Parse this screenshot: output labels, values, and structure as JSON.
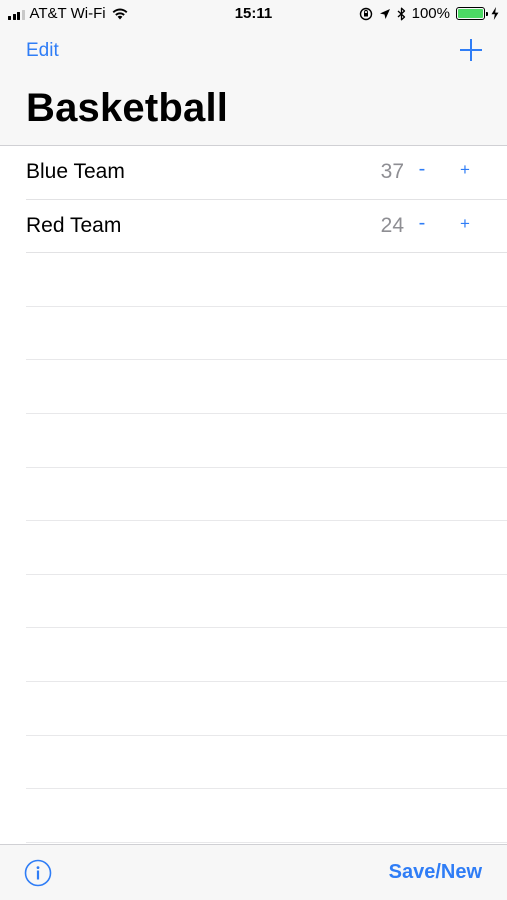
{
  "status_bar": {
    "carrier": "AT&T Wi-Fi",
    "time": "15:11",
    "battery": "100%"
  },
  "nav": {
    "edit_label": "Edit",
    "title": "Basketball",
    "add_icon": "plus-icon"
  },
  "teams": [
    {
      "name": "Blue Team",
      "score": "37",
      "minus": "-",
      "plus": "+"
    },
    {
      "name": "Red Team",
      "score": "24",
      "minus": "-",
      "plus": "+"
    }
  ],
  "toolbar": {
    "info_icon": "info-icon",
    "save_new_label": "Save/New"
  },
  "colors": {
    "accent": "#2f7df6",
    "score_gray": "#8e8e93",
    "battery_green": "#4cd964"
  }
}
